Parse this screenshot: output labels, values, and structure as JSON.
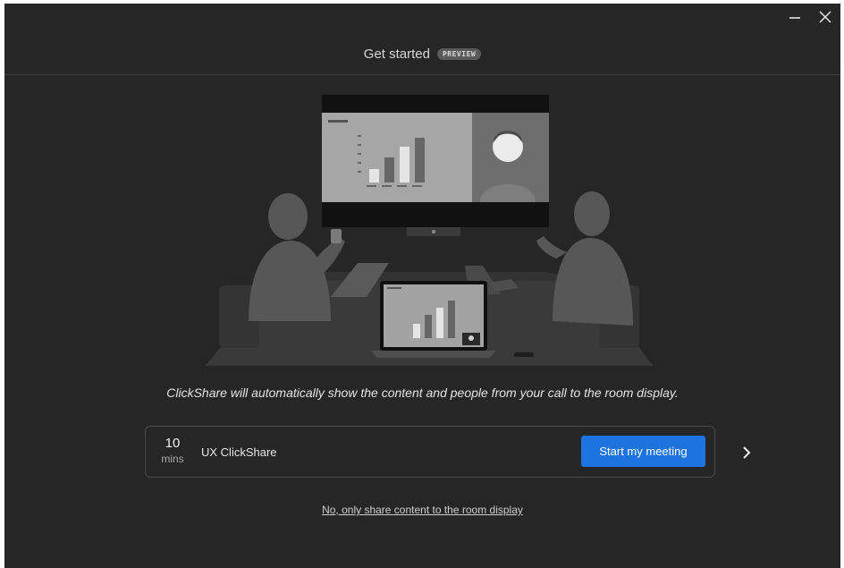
{
  "window": {
    "controls": {
      "minimize_icon": "minimize-icon",
      "close_icon": "close-icon"
    }
  },
  "header": {
    "title": "Get started",
    "badge": "PREVIEW"
  },
  "description": "ClickShare will automatically show the content and people from your call to the room display.",
  "meeting": {
    "duration_value": "10",
    "duration_unit": "mins",
    "name": "UX ClickShare",
    "start_button_label": "Start my meeting",
    "next_icon": "chevron-right-icon"
  },
  "share_link": "No, only share content to the room display",
  "colors": {
    "background": "#262626",
    "accent": "#1d74e0",
    "text": "#e4e4e4"
  }
}
